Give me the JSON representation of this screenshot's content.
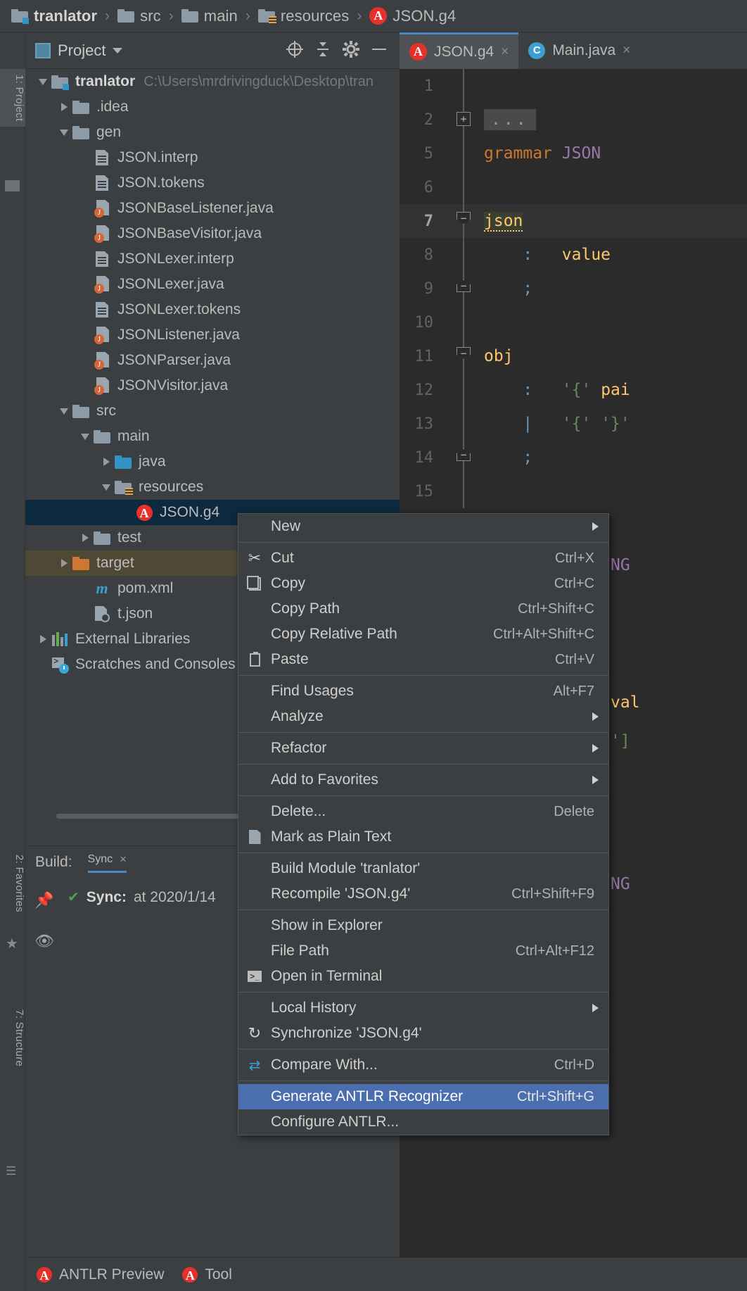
{
  "breadcrumb": {
    "items": [
      {
        "label": "tranlator",
        "icon": "module-folder-icon"
      },
      {
        "label": "src",
        "icon": "folder-icon"
      },
      {
        "label": "main",
        "icon": "folder-icon"
      },
      {
        "label": "resources",
        "icon": "resources-folder-icon"
      },
      {
        "label": "JSON.g4",
        "icon": "antlr-file-icon"
      }
    ],
    "separator": "›"
  },
  "left_strip": {
    "project_tab": "1: Project",
    "favorites_tab": "2: Favorites",
    "structure_tab": "7: Structure"
  },
  "project_panel": {
    "title": "Project",
    "toolbar": {
      "locate_icon": "locate-icon",
      "collapse_icon": "collapse-all-icon",
      "settings_icon": "gear-icon",
      "hide_icon": "minimize-icon"
    },
    "tree": [
      {
        "label": "tranlator",
        "path": "C:\\Users\\mrdrivingduck\\Desktop\\tran",
        "indent": 0,
        "arrow": "down",
        "icon": "module-folder-icon",
        "bold": true
      },
      {
        "label": ".idea",
        "path": "",
        "indent": 1,
        "arrow": "right",
        "icon": "folder-icon",
        "bold": false
      },
      {
        "label": "gen",
        "path": "",
        "indent": 1,
        "arrow": "down",
        "icon": "folder-icon",
        "bold": false
      },
      {
        "label": "JSON.interp",
        "path": "",
        "indent": 2,
        "arrow": "none",
        "icon": "file-icon",
        "bold": false
      },
      {
        "label": "JSON.tokens",
        "path": "",
        "indent": 2,
        "arrow": "none",
        "icon": "file-icon",
        "bold": false
      },
      {
        "label": "JSONBaseListener.java",
        "path": "",
        "indent": 2,
        "arrow": "none",
        "icon": "java-file-icon",
        "bold": false
      },
      {
        "label": "JSONBaseVisitor.java",
        "path": "",
        "indent": 2,
        "arrow": "none",
        "icon": "java-file-icon",
        "bold": false
      },
      {
        "label": "JSONLexer.interp",
        "path": "",
        "indent": 2,
        "arrow": "none",
        "icon": "file-icon",
        "bold": false
      },
      {
        "label": "JSONLexer.java",
        "path": "",
        "indent": 2,
        "arrow": "none",
        "icon": "java-file-icon",
        "bold": false
      },
      {
        "label": "JSONLexer.tokens",
        "path": "",
        "indent": 2,
        "arrow": "none",
        "icon": "file-icon",
        "bold": false
      },
      {
        "label": "JSONListener.java",
        "path": "",
        "indent": 2,
        "arrow": "none",
        "icon": "java-file-icon",
        "bold": false
      },
      {
        "label": "JSONParser.java",
        "path": "",
        "indent": 2,
        "arrow": "none",
        "icon": "java-file-icon",
        "bold": false
      },
      {
        "label": "JSONVisitor.java",
        "path": "",
        "indent": 2,
        "arrow": "none",
        "icon": "java-file-icon",
        "bold": false
      },
      {
        "label": "src",
        "path": "",
        "indent": 1,
        "arrow": "down",
        "icon": "folder-icon",
        "bold": false
      },
      {
        "label": "main",
        "path": "",
        "indent": 2,
        "arrow": "down",
        "icon": "folder-icon",
        "bold": false
      },
      {
        "label": "java",
        "path": "",
        "indent": 3,
        "arrow": "right",
        "icon": "source-folder-icon",
        "bold": false
      },
      {
        "label": "resources",
        "path": "",
        "indent": 3,
        "arrow": "down",
        "icon": "resources-folder-icon",
        "bold": false
      },
      {
        "label": "JSON.g4",
        "path": "",
        "indent": 4,
        "arrow": "none",
        "icon": "antlr-file-icon",
        "bold": false,
        "selected": true
      },
      {
        "label": "test",
        "path": "",
        "indent": 2,
        "arrow": "right",
        "icon": "folder-icon",
        "bold": false
      },
      {
        "label": "target",
        "path": "",
        "indent": 1,
        "arrow": "right",
        "icon": "excluded-folder-icon",
        "bold": false,
        "highlight": true
      },
      {
        "label": "pom.xml",
        "path": "",
        "indent": 2,
        "arrow": "none",
        "icon": "maven-icon",
        "bold": false
      },
      {
        "label": "t.json",
        "path": "",
        "indent": 2,
        "arrow": "none",
        "icon": "json-file-icon",
        "bold": false
      },
      {
        "label": "External Libraries",
        "path": "",
        "indent": 0,
        "arrow": "right",
        "icon": "libraries-icon",
        "bold": false
      },
      {
        "label": "Scratches and Consoles",
        "path": "",
        "indent": 0,
        "arrow": "none",
        "icon": "scratches-icon",
        "bold": false
      }
    ]
  },
  "build_panel": {
    "label": "Build:",
    "tab": "Sync",
    "close": "×",
    "status": "Sync:",
    "status_detail": "at 2020/1/14",
    "check": "✔",
    "pin_icon": "pin-icon",
    "eye_icon": "eye-icon"
  },
  "editor": {
    "tabs": [
      {
        "label": "JSON.g4",
        "icon": "antlr-file-icon",
        "active": true,
        "close": "×"
      },
      {
        "label": "Main.java",
        "icon": "java-class-icon",
        "active": false,
        "close": "×"
      }
    ],
    "lines": [
      {
        "num": "1",
        "fold": "",
        "text": "",
        "cls": ""
      },
      {
        "num": "2",
        "fold": "plus",
        "text": "…",
        "cls": "ellipsis"
      },
      {
        "num": "5",
        "fold": "",
        "text": "grammar JSON",
        "cls": "grammar"
      },
      {
        "num": "6",
        "fold": "",
        "text": "",
        "cls": ""
      },
      {
        "num": "7",
        "fold": "minus",
        "text": "json",
        "cls": "rulename-current"
      },
      {
        "num": "8",
        "fold": "",
        "text": "    :   value",
        "cls": "alt"
      },
      {
        "num": "9",
        "fold": "end",
        "text": "    ;",
        "cls": "alt"
      },
      {
        "num": "10",
        "fold": "",
        "text": "",
        "cls": ""
      },
      {
        "num": "11",
        "fold": "minus",
        "text": "obj",
        "cls": "rulename"
      },
      {
        "num": "12",
        "fold": "",
        "text": "    :   '{' pai",
        "cls": "alt"
      },
      {
        "num": "13",
        "fold": "",
        "text": "    |   '{' '}'",
        "cls": "alt"
      },
      {
        "num": "14",
        "fold": "end",
        "text": "    ;",
        "cls": "alt"
      },
      {
        "num": "15",
        "fold": "",
        "text": "",
        "cls": ""
      }
    ],
    "far_fragments": [
      "NG",
      "val",
      "']",
      "NG"
    ]
  },
  "context_menu": {
    "items": [
      {
        "label": "New",
        "shortcut": "",
        "icon": "",
        "submenu": true,
        "mnemonic": "",
        "sep_after": true
      },
      {
        "label": "Cut",
        "shortcut": "Ctrl+X",
        "icon": "scissors-icon",
        "submenu": false,
        "mnemonic": "t"
      },
      {
        "label": "Copy",
        "shortcut": "Ctrl+C",
        "icon": "copy-icon",
        "submenu": false,
        "mnemonic": "C"
      },
      {
        "label": "Copy Path",
        "shortcut": "Ctrl+Shift+C",
        "icon": "",
        "submenu": false,
        "mnemonic": "o"
      },
      {
        "label": "Copy Relative Path",
        "shortcut": "Ctrl+Alt+Shift+C",
        "icon": "",
        "submenu": false,
        "mnemonic": "y"
      },
      {
        "label": "Paste",
        "shortcut": "Ctrl+V",
        "icon": "paste-icon",
        "submenu": false,
        "mnemonic": "P",
        "sep_after": true
      },
      {
        "label": "Find Usages",
        "shortcut": "Alt+F7",
        "icon": "",
        "submenu": false,
        "mnemonic": "U"
      },
      {
        "label": "Analyze",
        "shortcut": "",
        "icon": "",
        "submenu": true,
        "mnemonic": "z",
        "sep_after": true
      },
      {
        "label": "Refactor",
        "shortcut": "",
        "icon": "",
        "submenu": true,
        "mnemonic": "R",
        "sep_after": true
      },
      {
        "label": "Add to Favorites",
        "shortcut": "",
        "icon": "",
        "submenu": true,
        "mnemonic": "a",
        "sep_after": true
      },
      {
        "label": "Delete...",
        "shortcut": "Delete",
        "icon": "",
        "submenu": false,
        "mnemonic": "D"
      },
      {
        "label": "Mark as Plain Text",
        "shortcut": "",
        "icon": "plain-text-icon",
        "submenu": false,
        "sep_after": true
      },
      {
        "label": "Build Module 'tranlator'",
        "shortcut": "",
        "icon": "",
        "submenu": false,
        "mnemonic": "M"
      },
      {
        "label": "Recompile 'JSON.g4'",
        "shortcut": "Ctrl+Shift+F9",
        "icon": "",
        "submenu": false,
        "mnemonic": "e",
        "sep_after": true
      },
      {
        "label": "Show in Explorer",
        "shortcut": "",
        "icon": "",
        "submenu": false
      },
      {
        "label": "File Path",
        "shortcut": "Ctrl+Alt+F12",
        "icon": "",
        "submenu": false,
        "mnemonic": "P"
      },
      {
        "label": "Open in Terminal",
        "shortcut": "",
        "icon": "terminal-icon",
        "submenu": false,
        "sep_after": true
      },
      {
        "label": "Local History",
        "shortcut": "",
        "icon": "",
        "submenu": true,
        "mnemonic": "H"
      },
      {
        "label": "Synchronize 'JSON.g4'",
        "shortcut": "",
        "icon": "sync-icon",
        "submenu": false,
        "sep_after": true
      },
      {
        "label": "Compare With...",
        "shortcut": "Ctrl+D",
        "icon": "compare-icon",
        "submenu": false,
        "sep_after": true
      },
      {
        "label": "Generate ANTLR Recognizer",
        "shortcut": "Ctrl+Shift+G",
        "icon": "",
        "submenu": false,
        "highlighted": true
      },
      {
        "label": "Configure ANTLR...",
        "shortcut": "",
        "icon": "",
        "submenu": false
      }
    ],
    "highlight_color": "#4b6eaf"
  },
  "bottom_bar": {
    "items": [
      {
        "label": "ANTLR Preview",
        "icon": "antlr-file-icon"
      },
      {
        "label": "Tool",
        "icon": "antlr-file-icon"
      }
    ]
  },
  "colors": {
    "bg": "#3c3f41",
    "editor_bg": "#2b2b2b",
    "selection": "#0d293e",
    "accent": "#4b6eaf",
    "antlr_red": "#e8302b",
    "target_highlight": "#4e4835"
  }
}
